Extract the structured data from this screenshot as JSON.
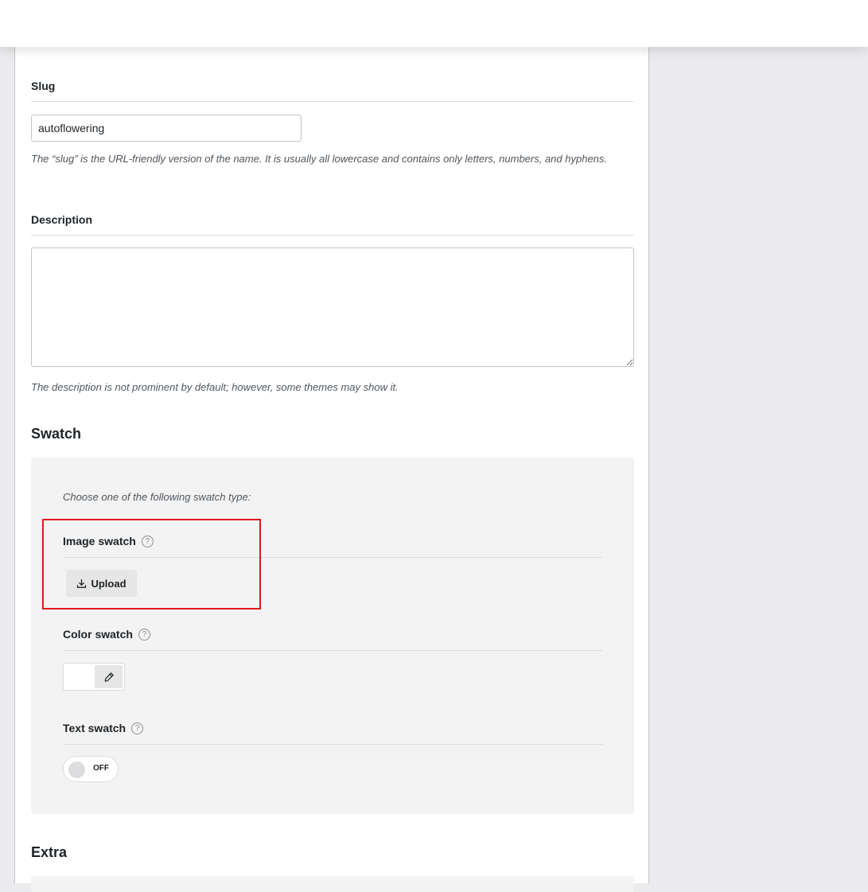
{
  "slug": {
    "label": "Slug",
    "value": "autoflowering",
    "help": "The “slug” is the URL-friendly version of the name. It is usually all lowercase and contains only letters, numbers, and hyphens."
  },
  "description": {
    "label": "Description",
    "value": "",
    "help": "The description is not prominent by default; however, some themes may show it."
  },
  "swatch": {
    "title": "Swatch",
    "intro": "Choose one of the following swatch type:",
    "image": {
      "label": "Image swatch",
      "help_icon": "question-circle-icon",
      "upload_label": "Upload",
      "upload_icon": "download-icon"
    },
    "color": {
      "label": "Color swatch",
      "help_icon": "question-circle-icon",
      "picker_icon": "eyedropper-icon",
      "value": "#ffffff"
    },
    "text": {
      "label": "Text swatch",
      "help_icon": "question-circle-icon",
      "toggle_state": "OFF"
    }
  },
  "extra": {
    "title": "Extra"
  },
  "colors": {
    "highlight": "#e0171f",
    "panel_bg": "#f3f3f3",
    "page_bg": "#ebebed"
  }
}
